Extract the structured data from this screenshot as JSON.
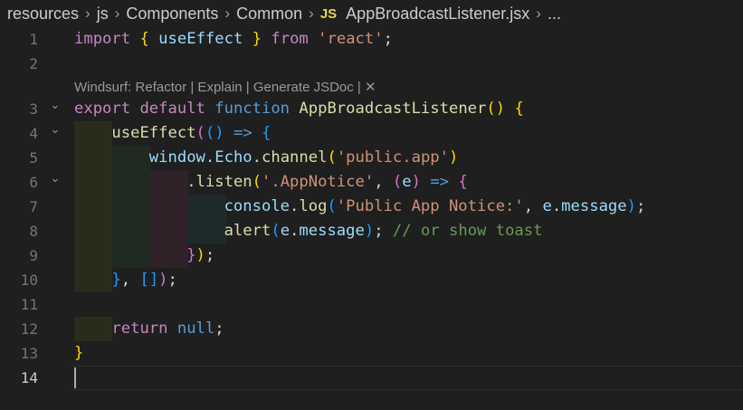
{
  "breadcrumb": {
    "items": [
      "resources",
      "js",
      "Components",
      "Common"
    ],
    "file_icon": "JS",
    "file_name": "AppBroadcastListener.jsx",
    "more": "..."
  },
  "codelens": "Windsurf: Refactor | Explain | Generate JSDoc | ✕",
  "line_numbers": [
    "1",
    "2",
    "3",
    "4",
    "5",
    "6",
    "7",
    "8",
    "9",
    "10",
    "11",
    "12",
    "13",
    "14"
  ],
  "fold_icon": "chevron-down-icon",
  "lines": [
    [
      [
        "import",
        "ctl"
      ],
      [
        " ",
        "punc"
      ],
      [
        "{",
        "b1"
      ],
      [
        " ",
        "punc"
      ],
      [
        "useEffect",
        "var"
      ],
      [
        " ",
        "punc"
      ],
      [
        "}",
        "b1"
      ],
      [
        " ",
        "punc"
      ],
      [
        "from",
        "ctl"
      ],
      [
        " ",
        "punc"
      ],
      [
        "'react'",
        "str"
      ],
      [
        ";",
        "punc"
      ]
    ],
    [],
    [
      [
        "export",
        "ctl"
      ],
      [
        " ",
        "punc"
      ],
      [
        "default",
        "ctl"
      ],
      [
        " ",
        "punc"
      ],
      [
        "function",
        "kw"
      ],
      [
        " ",
        "punc"
      ],
      [
        "AppBroadcastListener",
        "fn"
      ],
      [
        "()",
        "b1"
      ],
      [
        " ",
        "punc"
      ],
      [
        "{",
        "b1"
      ]
    ],
    [
      [
        "    ",
        "punc"
      ],
      [
        "useEffect",
        "fn"
      ],
      [
        "(",
        "b2"
      ],
      [
        "()",
        "b3"
      ],
      [
        " ",
        "punc"
      ],
      [
        "=>",
        "kw"
      ],
      [
        " ",
        "punc"
      ],
      [
        "{",
        "b3"
      ]
    ],
    [
      [
        "        ",
        "punc"
      ],
      [
        "window",
        "var"
      ],
      [
        ".",
        "punc"
      ],
      [
        "Echo",
        "var"
      ],
      [
        ".",
        "punc"
      ],
      [
        "channel",
        "fn"
      ],
      [
        "(",
        "b1"
      ],
      [
        "'public.app'",
        "str"
      ],
      [
        ")",
        "b1"
      ]
    ],
    [
      [
        "            ",
        "punc"
      ],
      [
        ".",
        "punc"
      ],
      [
        "listen",
        "fn"
      ],
      [
        "(",
        "b1"
      ],
      [
        "'.AppNotice'",
        "str"
      ],
      [
        ", ",
        "punc"
      ],
      [
        "(",
        "b2"
      ],
      [
        "e",
        "var"
      ],
      [
        ")",
        "b2"
      ],
      [
        " ",
        "punc"
      ],
      [
        "=>",
        "kw"
      ],
      [
        " ",
        "punc"
      ],
      [
        "{",
        "b2"
      ]
    ],
    [
      [
        "                ",
        "punc"
      ],
      [
        "console",
        "var"
      ],
      [
        ".",
        "punc"
      ],
      [
        "log",
        "fn"
      ],
      [
        "(",
        "b3"
      ],
      [
        "'Public App Notice:'",
        "str"
      ],
      [
        ", ",
        "punc"
      ],
      [
        "e",
        "var"
      ],
      [
        ".",
        "punc"
      ],
      [
        "message",
        "var"
      ],
      [
        ")",
        "b3"
      ],
      [
        ";",
        "punc"
      ]
    ],
    [
      [
        "                ",
        "punc"
      ],
      [
        "alert",
        "fn"
      ],
      [
        "(",
        "b3"
      ],
      [
        "e",
        "var"
      ],
      [
        ".",
        "punc"
      ],
      [
        "message",
        "var"
      ],
      [
        ")",
        "b3"
      ],
      [
        "; ",
        "punc"
      ],
      [
        "// or show toast",
        "cmt"
      ]
    ],
    [
      [
        "            ",
        "punc"
      ],
      [
        "}",
        "b2"
      ],
      [
        ")",
        "b1"
      ],
      [
        ";",
        "punc"
      ]
    ],
    [
      [
        "    ",
        "punc"
      ],
      [
        "}",
        "b3"
      ],
      [
        ", ",
        "punc"
      ],
      [
        "[]",
        "b3"
      ],
      [
        ")",
        "b2"
      ],
      [
        ";",
        "punc"
      ]
    ],
    [],
    [
      [
        "    ",
        "punc"
      ],
      [
        "return",
        "ctl"
      ],
      [
        " ",
        "punc"
      ],
      [
        "null",
        "kw"
      ],
      [
        ";",
        "punc"
      ]
    ],
    [
      [
        "}",
        "b1"
      ]
    ],
    []
  ],
  "colors": {
    "background": "#1f1f1f",
    "indent_band_1": "#2b2b1c",
    "indent_band_2": "#1e2a22",
    "indent_band_3": "#2f2229",
    "indent_band_4": "#1e2a2c"
  }
}
